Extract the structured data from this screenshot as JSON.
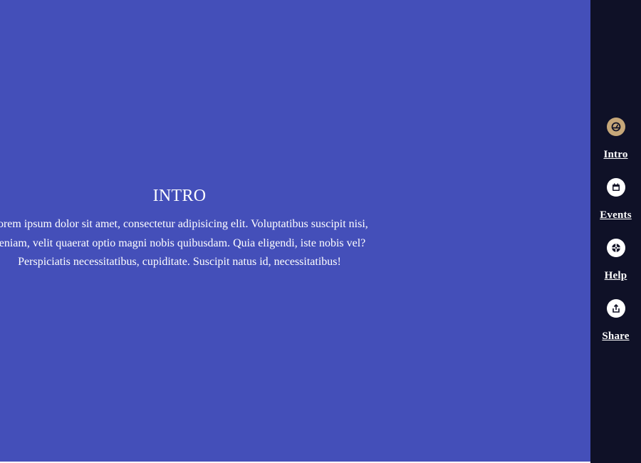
{
  "intro": {
    "title": "INTRO",
    "line1": "Lorem ipsum dolor sit amet, consectetur adipisicing elit. Voluptatibus suscipit nisi,",
    "line2": "veniam, velit quaerat optio magni nobis quibusdam. Quia eligendi, iste nobis vel?",
    "line3": "Perspiciatis necessitatibus, cupiditate. Suscipit natus id, necessitatibus!"
  },
  "sidebar": {
    "items": [
      {
        "label": "Intro",
        "icon": "dashboard-icon",
        "active": true
      },
      {
        "label": "Events",
        "icon": "calendar-icon",
        "active": false
      },
      {
        "label": "Help",
        "icon": "lifebuoy-icon",
        "active": false
      },
      {
        "label": "Share",
        "icon": "share-icon",
        "active": false
      }
    ]
  },
  "colors": {
    "main_background": "#444fb9",
    "sidebar_background": "#0f1127",
    "active_icon": "#c6a779",
    "icon_background": "#ffffff",
    "text": "#ffffff"
  }
}
